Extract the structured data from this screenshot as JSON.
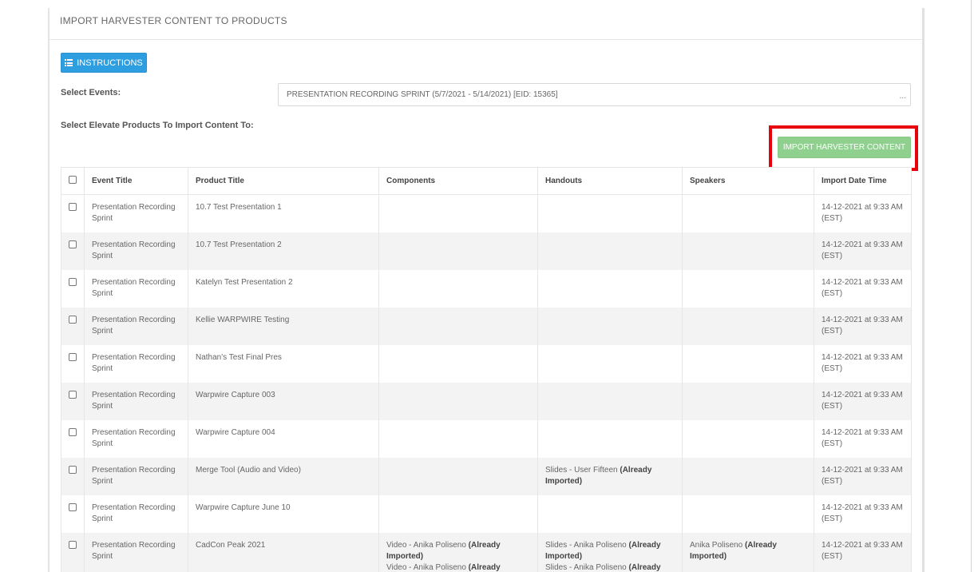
{
  "panel": {
    "title": "IMPORT HARVESTER CONTENT TO PRODUCTS"
  },
  "toolbar": {
    "instructions_label": "INSTRUCTIONS",
    "instructions_icon": "list-icon",
    "import_label": "IMPORT HARVESTER CONTENT",
    "import_button_color": "#8fd08f",
    "highlight_color": "#e8000a",
    "instructions_color": "#2d9ee0"
  },
  "form": {
    "events_label": "Select Events:",
    "events_value": "PRESENTATION RECORDING SPRINT (5/7/2021 - 5/14/2021) [EID: 15365]",
    "events_more": "...",
    "products_label": "Select Elevate Products To Import Content To:"
  },
  "table": {
    "columns": [
      "Event Title",
      "Product Title",
      "Components",
      "Handouts",
      "Speakers",
      "Import Date Time"
    ],
    "rows": [
      {
        "event": "Presentation Recording Sprint",
        "product": "10.7 Test Presentation 1",
        "components": [],
        "handouts": [],
        "speakers": [],
        "import_date": "14-12-2021 at 9:33 AM (EST)"
      },
      {
        "event": "Presentation Recording Sprint",
        "product": "10.7 Test Presentation 2",
        "components": [],
        "handouts": [],
        "speakers": [],
        "import_date": "14-12-2021 at 9:33 AM (EST)"
      },
      {
        "event": "Presentation Recording Sprint",
        "product": "Katelyn Test Presentation 2",
        "components": [],
        "handouts": [],
        "speakers": [],
        "import_date": "14-12-2021 at 9:33 AM (EST)"
      },
      {
        "event": "Presentation Recording Sprint",
        "product": "Kellie WARPWIRE Testing",
        "components": [],
        "handouts": [],
        "speakers": [],
        "import_date": "14-12-2021 at 9:33 AM (EST)"
      },
      {
        "event": "Presentation Recording Sprint",
        "product": "Nathan's Test Final Pres",
        "components": [],
        "handouts": [],
        "speakers": [],
        "import_date": "14-12-2021 at 9:33 AM (EST)"
      },
      {
        "event": "Presentation Recording Sprint",
        "product": "Warpwire Capture 003",
        "components": [],
        "handouts": [],
        "speakers": [],
        "import_date": "14-12-2021 at 9:33 AM (EST)"
      },
      {
        "event": "Presentation Recording Sprint",
        "product": "Warpwire Capture 004",
        "components": [],
        "handouts": [],
        "speakers": [],
        "import_date": "14-12-2021 at 9:33 AM (EST)"
      },
      {
        "event": "Presentation Recording Sprint",
        "product": "Merge Tool (Audio and Video)",
        "components": [],
        "handouts": [
          {
            "text": "Slides - User Fifteen",
            "status": "(Already Imported)"
          }
        ],
        "speakers": [],
        "import_date": "14-12-2021 at 9:33 AM (EST)"
      },
      {
        "event": "Presentation Recording Sprint",
        "product": "Warpwire Capture June 10",
        "components": [],
        "handouts": [],
        "speakers": [],
        "import_date": "14-12-2021 at 9:33 AM (EST)"
      },
      {
        "event": "Presentation Recording Sprint",
        "product": "CadCon Peak 2021",
        "components": [
          {
            "text": "Video - Anika Poliseno",
            "status": "(Already Imported)"
          },
          {
            "text": "Video - Anika Poliseno",
            "status": "(Already"
          }
        ],
        "handouts": [
          {
            "text": "Slides - Anika Poliseno",
            "status": "(Already Imported)"
          },
          {
            "text": "Slides - Anika Poliseno",
            "status": "(Already"
          }
        ],
        "speakers": [
          {
            "text": "Anika Poliseno",
            "status": "(Already Imported)"
          }
        ],
        "import_date": "14-12-2021 at 9:33 AM (EST)"
      }
    ]
  }
}
